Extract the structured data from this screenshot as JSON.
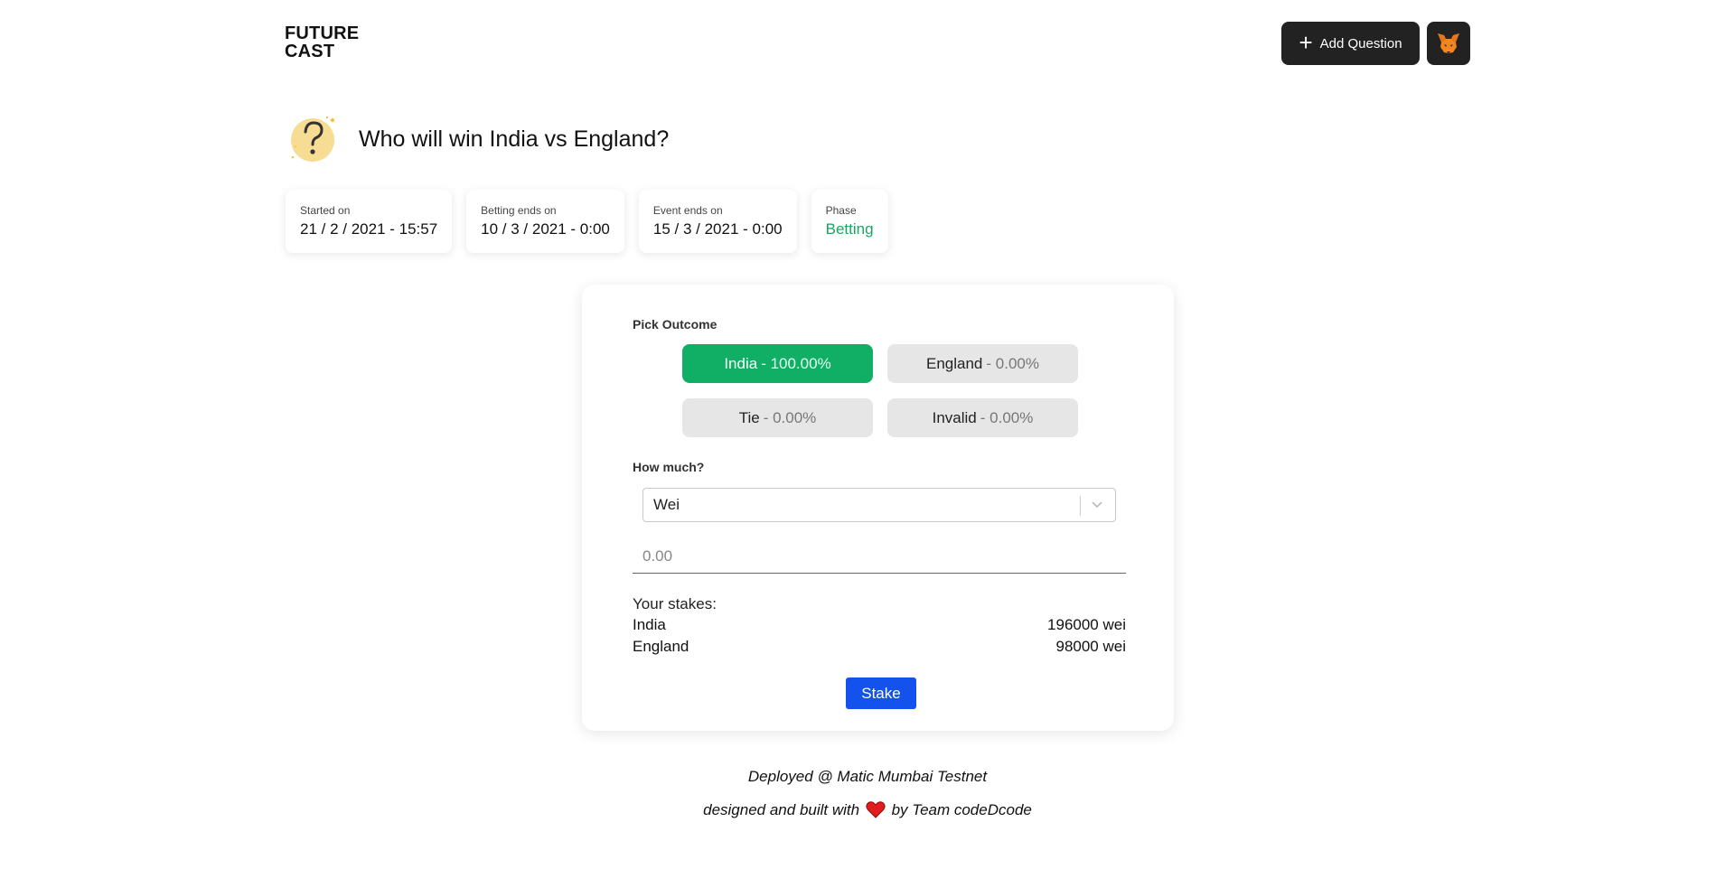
{
  "header": {
    "logo_line1": "FUTURE",
    "logo_line2": "CAST",
    "add_question_label": "Add Question",
    "wallet_icon": "metamask-fox-icon"
  },
  "question": {
    "icon": "question-mark-icon",
    "title": "Who will win India vs England?"
  },
  "info": [
    {
      "label": "Started on",
      "value": "21 / 2 / 2021 - 15:57"
    },
    {
      "label": "Betting ends on",
      "value": "10 / 3 / 2021 - 0:00"
    },
    {
      "label": "Event ends on",
      "value": "15 / 3 / 2021 - 0:00"
    },
    {
      "label": "Phase",
      "value": "Betting"
    }
  ],
  "bet": {
    "pick_label": "Pick Outcome",
    "outcomes": [
      {
        "name": "India",
        "pct": "- 100.00%",
        "selected": true
      },
      {
        "name": "England",
        "pct": "- 0.00%",
        "selected": false
      },
      {
        "name": "Tie",
        "pct": "- 0.00%",
        "selected": false
      },
      {
        "name": "Invalid",
        "pct": "- 0.00%",
        "selected": false
      }
    ],
    "how_much_label": "How much?",
    "unit_selected": "Wei",
    "amount_placeholder": "0.00",
    "stakes_title": "Your stakes:",
    "stakes": [
      {
        "name": "India",
        "amount": "196000 wei"
      },
      {
        "name": "England",
        "amount": "98000 wei"
      }
    ],
    "stake_button": "Stake"
  },
  "footer": {
    "deployed": "Deployed @ Matic Mumbai Testnet",
    "built_prefix": "designed and built with",
    "built_suffix": "by Team codeDcode"
  },
  "colors": {
    "accent_green": "#11ae66",
    "stake_blue": "#1452ee",
    "dark_button": "#222222",
    "phase_green": "#1aa561"
  }
}
